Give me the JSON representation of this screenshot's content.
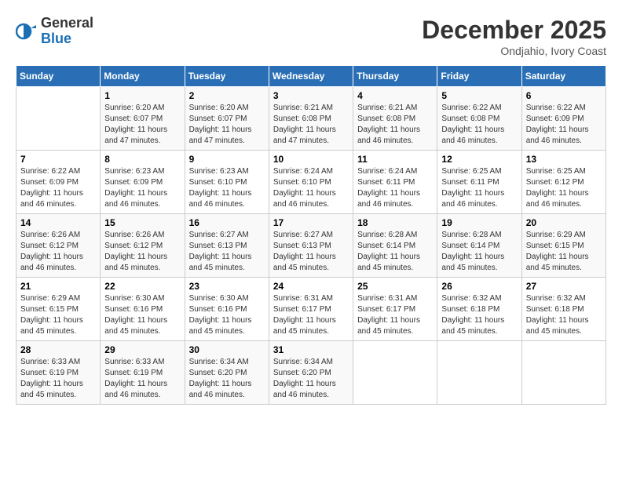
{
  "logo": {
    "general": "General",
    "blue": "Blue"
  },
  "title": "December 2025",
  "location": "Ondjahio, Ivory Coast",
  "weekdays": [
    "Sunday",
    "Monday",
    "Tuesday",
    "Wednesday",
    "Thursday",
    "Friday",
    "Saturday"
  ],
  "weeks": [
    [
      {
        "day": "",
        "info": ""
      },
      {
        "day": "1",
        "info": "Sunrise: 6:20 AM\nSunset: 6:07 PM\nDaylight: 11 hours and 47 minutes."
      },
      {
        "day": "2",
        "info": "Sunrise: 6:20 AM\nSunset: 6:07 PM\nDaylight: 11 hours and 47 minutes."
      },
      {
        "day": "3",
        "info": "Sunrise: 6:21 AM\nSunset: 6:08 PM\nDaylight: 11 hours and 47 minutes."
      },
      {
        "day": "4",
        "info": "Sunrise: 6:21 AM\nSunset: 6:08 PM\nDaylight: 11 hours and 46 minutes."
      },
      {
        "day": "5",
        "info": "Sunrise: 6:22 AM\nSunset: 6:08 PM\nDaylight: 11 hours and 46 minutes."
      },
      {
        "day": "6",
        "info": "Sunrise: 6:22 AM\nSunset: 6:09 PM\nDaylight: 11 hours and 46 minutes."
      }
    ],
    [
      {
        "day": "7",
        "info": "Sunrise: 6:22 AM\nSunset: 6:09 PM\nDaylight: 11 hours and 46 minutes."
      },
      {
        "day": "8",
        "info": "Sunrise: 6:23 AM\nSunset: 6:09 PM\nDaylight: 11 hours and 46 minutes."
      },
      {
        "day": "9",
        "info": "Sunrise: 6:23 AM\nSunset: 6:10 PM\nDaylight: 11 hours and 46 minutes."
      },
      {
        "day": "10",
        "info": "Sunrise: 6:24 AM\nSunset: 6:10 PM\nDaylight: 11 hours and 46 minutes."
      },
      {
        "day": "11",
        "info": "Sunrise: 6:24 AM\nSunset: 6:11 PM\nDaylight: 11 hours and 46 minutes."
      },
      {
        "day": "12",
        "info": "Sunrise: 6:25 AM\nSunset: 6:11 PM\nDaylight: 11 hours and 46 minutes."
      },
      {
        "day": "13",
        "info": "Sunrise: 6:25 AM\nSunset: 6:12 PM\nDaylight: 11 hours and 46 minutes."
      }
    ],
    [
      {
        "day": "14",
        "info": "Sunrise: 6:26 AM\nSunset: 6:12 PM\nDaylight: 11 hours and 46 minutes."
      },
      {
        "day": "15",
        "info": "Sunrise: 6:26 AM\nSunset: 6:12 PM\nDaylight: 11 hours and 45 minutes."
      },
      {
        "day": "16",
        "info": "Sunrise: 6:27 AM\nSunset: 6:13 PM\nDaylight: 11 hours and 45 minutes."
      },
      {
        "day": "17",
        "info": "Sunrise: 6:27 AM\nSunset: 6:13 PM\nDaylight: 11 hours and 45 minutes."
      },
      {
        "day": "18",
        "info": "Sunrise: 6:28 AM\nSunset: 6:14 PM\nDaylight: 11 hours and 45 minutes."
      },
      {
        "day": "19",
        "info": "Sunrise: 6:28 AM\nSunset: 6:14 PM\nDaylight: 11 hours and 45 minutes."
      },
      {
        "day": "20",
        "info": "Sunrise: 6:29 AM\nSunset: 6:15 PM\nDaylight: 11 hours and 45 minutes."
      }
    ],
    [
      {
        "day": "21",
        "info": "Sunrise: 6:29 AM\nSunset: 6:15 PM\nDaylight: 11 hours and 45 minutes."
      },
      {
        "day": "22",
        "info": "Sunrise: 6:30 AM\nSunset: 6:16 PM\nDaylight: 11 hours and 45 minutes."
      },
      {
        "day": "23",
        "info": "Sunrise: 6:30 AM\nSunset: 6:16 PM\nDaylight: 11 hours and 45 minutes."
      },
      {
        "day": "24",
        "info": "Sunrise: 6:31 AM\nSunset: 6:17 PM\nDaylight: 11 hours and 45 minutes."
      },
      {
        "day": "25",
        "info": "Sunrise: 6:31 AM\nSunset: 6:17 PM\nDaylight: 11 hours and 45 minutes."
      },
      {
        "day": "26",
        "info": "Sunrise: 6:32 AM\nSunset: 6:18 PM\nDaylight: 11 hours and 45 minutes."
      },
      {
        "day": "27",
        "info": "Sunrise: 6:32 AM\nSunset: 6:18 PM\nDaylight: 11 hours and 45 minutes."
      }
    ],
    [
      {
        "day": "28",
        "info": "Sunrise: 6:33 AM\nSunset: 6:19 PM\nDaylight: 11 hours and 45 minutes."
      },
      {
        "day": "29",
        "info": "Sunrise: 6:33 AM\nSunset: 6:19 PM\nDaylight: 11 hours and 46 minutes."
      },
      {
        "day": "30",
        "info": "Sunrise: 6:34 AM\nSunset: 6:20 PM\nDaylight: 11 hours and 46 minutes."
      },
      {
        "day": "31",
        "info": "Sunrise: 6:34 AM\nSunset: 6:20 PM\nDaylight: 11 hours and 46 minutes."
      },
      {
        "day": "",
        "info": ""
      },
      {
        "day": "",
        "info": ""
      },
      {
        "day": "",
        "info": ""
      }
    ]
  ]
}
